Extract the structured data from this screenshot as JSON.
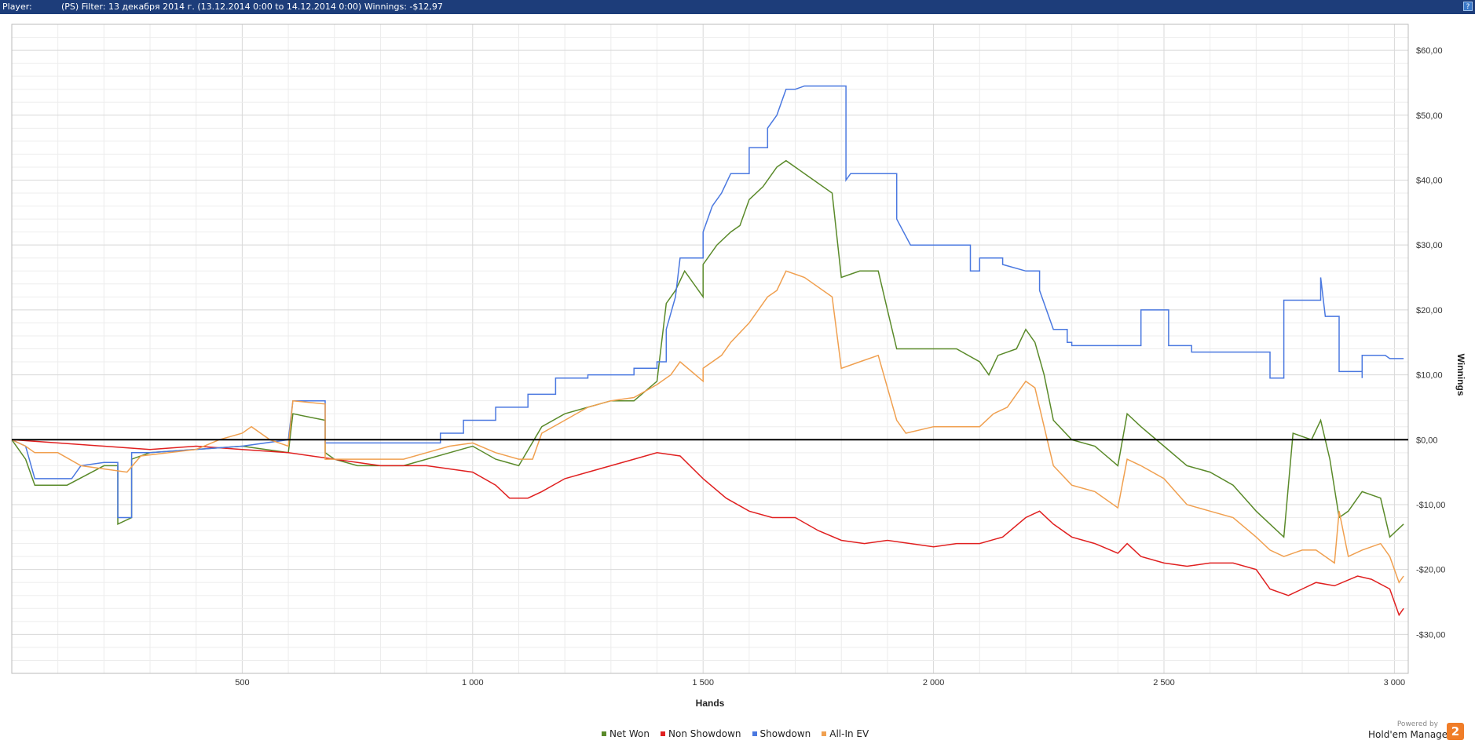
{
  "header": {
    "player_label": "Player:",
    "filter_text": "(PS) Filter: 13 декабря 2014 г. (13.12.2014 0:00 to 14.12.2014 0:00) Winnings: -$12,97",
    "help_label": "?"
  },
  "footer": {
    "powered_by": "Powered by",
    "brand": "Hold'em Manager",
    "logo_text": "2"
  },
  "chart_data": {
    "type": "line",
    "title": "",
    "xlabel": "Hands",
    "ylabel": "Winnings",
    "xlim": [
      0,
      3030
    ],
    "ylim": [
      -36,
      64
    ],
    "x_ticks": [
      500,
      1000,
      1500,
      2000,
      2500,
      3000
    ],
    "x_tick_labels": [
      "500",
      "1 000",
      "1 500",
      "2 000",
      "2 500",
      "3 000"
    ],
    "y_ticks": [
      -30,
      -20,
      -10,
      0,
      10,
      20,
      30,
      40,
      50,
      60
    ],
    "y_tick_labels": [
      "-$30,00",
      "-$20,00",
      "-$10,00",
      "$0,00",
      "$10,00",
      "$20,00",
      "$30,00",
      "$40,00",
      "$50,00",
      "$60,00"
    ],
    "grid": true,
    "legend_position": "bottom-center",
    "series": [
      {
        "name": "Net Won",
        "color": "#5a8a2a",
        "points": [
          [
            0,
            0
          ],
          [
            30,
            -3
          ],
          [
            50,
            -7
          ],
          [
            120,
            -7
          ],
          [
            200,
            -4
          ],
          [
            230,
            -4
          ],
          [
            230,
            -13
          ],
          [
            260,
            -12
          ],
          [
            260,
            -3
          ],
          [
            300,
            -2
          ],
          [
            500,
            -1
          ],
          [
            600,
            -2
          ],
          [
            610,
            4
          ],
          [
            680,
            3
          ],
          [
            680,
            -2
          ],
          [
            700,
            -3
          ],
          [
            750,
            -4
          ],
          [
            850,
            -4
          ],
          [
            900,
            -3
          ],
          [
            950,
            -2
          ],
          [
            1000,
            -1
          ],
          [
            1050,
            -3
          ],
          [
            1100,
            -4
          ],
          [
            1150,
            2
          ],
          [
            1200,
            4
          ],
          [
            1250,
            5
          ],
          [
            1300,
            6
          ],
          [
            1350,
            6
          ],
          [
            1400,
            9
          ],
          [
            1420,
            21
          ],
          [
            1440,
            23
          ],
          [
            1460,
            26
          ],
          [
            1500,
            22
          ],
          [
            1500,
            27
          ],
          [
            1530,
            30
          ],
          [
            1560,
            32
          ],
          [
            1580,
            33
          ],
          [
            1600,
            37
          ],
          [
            1630,
            39
          ],
          [
            1660,
            42
          ],
          [
            1680,
            43
          ],
          [
            1720,
            41
          ],
          [
            1780,
            38
          ],
          [
            1800,
            25
          ],
          [
            1840,
            26
          ],
          [
            1880,
            26
          ],
          [
            1900,
            20
          ],
          [
            1920,
            14
          ],
          [
            1950,
            14
          ],
          [
            2000,
            14
          ],
          [
            2050,
            14
          ],
          [
            2100,
            12
          ],
          [
            2120,
            10
          ],
          [
            2140,
            13
          ],
          [
            2180,
            14
          ],
          [
            2200,
            17
          ],
          [
            2220,
            15
          ],
          [
            2240,
            10
          ],
          [
            2260,
            3
          ],
          [
            2300,
            0
          ],
          [
            2350,
            -1
          ],
          [
            2400,
            -4
          ],
          [
            2420,
            4
          ],
          [
            2450,
            2
          ],
          [
            2500,
            -1
          ],
          [
            2550,
            -4
          ],
          [
            2600,
            -5
          ],
          [
            2650,
            -7
          ],
          [
            2700,
            -11
          ],
          [
            2730,
            -13
          ],
          [
            2760,
            -15
          ],
          [
            2780,
            1
          ],
          [
            2820,
            0
          ],
          [
            2840,
            3
          ],
          [
            2860,
            -3
          ],
          [
            2880,
            -12
          ],
          [
            2900,
            -11
          ],
          [
            2930,
            -8
          ],
          [
            2970,
            -9
          ],
          [
            2990,
            -15
          ],
          [
            3020,
            -13
          ]
        ]
      },
      {
        "name": "Non Showdown",
        "color": "#e02020",
        "points": [
          [
            0,
            0
          ],
          [
            100,
            -0.5
          ],
          [
            200,
            -1
          ],
          [
            300,
            -1.5
          ],
          [
            400,
            -1
          ],
          [
            500,
            -1.5
          ],
          [
            600,
            -2
          ],
          [
            700,
            -3
          ],
          [
            800,
            -4
          ],
          [
            900,
            -4
          ],
          [
            950,
            -4.5
          ],
          [
            1000,
            -5
          ],
          [
            1050,
            -7
          ],
          [
            1080,
            -9
          ],
          [
            1120,
            -9
          ],
          [
            1150,
            -8
          ],
          [
            1200,
            -6
          ],
          [
            1250,
            -5
          ],
          [
            1300,
            -4
          ],
          [
            1350,
            -3
          ],
          [
            1400,
            -2
          ],
          [
            1450,
            -2.5
          ],
          [
            1500,
            -6
          ],
          [
            1550,
            -9
          ],
          [
            1600,
            -11
          ],
          [
            1650,
            -12
          ],
          [
            1700,
            -12
          ],
          [
            1750,
            -14
          ],
          [
            1800,
            -15.5
          ],
          [
            1850,
            -16
          ],
          [
            1900,
            -15.5
          ],
          [
            1950,
            -16
          ],
          [
            2000,
            -16.5
          ],
          [
            2050,
            -16
          ],
          [
            2100,
            -16
          ],
          [
            2150,
            -15
          ],
          [
            2200,
            -12
          ],
          [
            2230,
            -11
          ],
          [
            2260,
            -13
          ],
          [
            2300,
            -15
          ],
          [
            2350,
            -16
          ],
          [
            2400,
            -17.5
          ],
          [
            2420,
            -16
          ],
          [
            2450,
            -18
          ],
          [
            2500,
            -19
          ],
          [
            2550,
            -19.5
          ],
          [
            2600,
            -19
          ],
          [
            2650,
            -19
          ],
          [
            2700,
            -20
          ],
          [
            2730,
            -23
          ],
          [
            2770,
            -24
          ],
          [
            2800,
            -23
          ],
          [
            2830,
            -22
          ],
          [
            2870,
            -22.5
          ],
          [
            2920,
            -21
          ],
          [
            2950,
            -21.5
          ],
          [
            2990,
            -23
          ],
          [
            3010,
            -27
          ],
          [
            3020,
            -26
          ]
        ]
      },
      {
        "name": "Showdown",
        "color": "#4a78e0",
        "points": [
          [
            0,
            0
          ],
          [
            30,
            -1
          ],
          [
            50,
            -6
          ],
          [
            130,
            -6
          ],
          [
            150,
            -4
          ],
          [
            200,
            -3.5
          ],
          [
            230,
            -3.5
          ],
          [
            230,
            -12
          ],
          [
            260,
            -12
          ],
          [
            260,
            -2
          ],
          [
            300,
            -2
          ],
          [
            500,
            -1
          ],
          [
            600,
            0
          ],
          [
            610,
            6
          ],
          [
            680,
            6
          ],
          [
            680,
            -0.5
          ],
          [
            930,
            -0.5
          ],
          [
            930,
            1
          ],
          [
            980,
            1
          ],
          [
            980,
            3
          ],
          [
            1050,
            3
          ],
          [
            1050,
            5
          ],
          [
            1120,
            5
          ],
          [
            1120,
            7
          ],
          [
            1180,
            7
          ],
          [
            1180,
            9.5
          ],
          [
            1250,
            9.5
          ],
          [
            1250,
            10
          ],
          [
            1350,
            10
          ],
          [
            1350,
            11
          ],
          [
            1400,
            11
          ],
          [
            1400,
            12
          ],
          [
            1420,
            12
          ],
          [
            1420,
            17
          ],
          [
            1440,
            22
          ],
          [
            1450,
            28
          ],
          [
            1500,
            28
          ],
          [
            1500,
            32
          ],
          [
            1520,
            36
          ],
          [
            1540,
            38
          ],
          [
            1560,
            41
          ],
          [
            1600,
            41
          ],
          [
            1600,
            45
          ],
          [
            1640,
            45
          ],
          [
            1640,
            48
          ],
          [
            1660,
            50
          ],
          [
            1680,
            54
          ],
          [
            1700,
            54
          ],
          [
            1720,
            54.5
          ],
          [
            1810,
            54.5
          ],
          [
            1810,
            40
          ],
          [
            1820,
            41
          ],
          [
            1920,
            41
          ],
          [
            1920,
            34
          ],
          [
            1950,
            30
          ],
          [
            2080,
            30
          ],
          [
            2080,
            26
          ],
          [
            2100,
            26
          ],
          [
            2100,
            28
          ],
          [
            2150,
            28
          ],
          [
            2150,
            27
          ],
          [
            2200,
            26
          ],
          [
            2230,
            26
          ],
          [
            2230,
            23
          ],
          [
            2260,
            17
          ],
          [
            2290,
            17
          ],
          [
            2290,
            15
          ],
          [
            2300,
            15
          ],
          [
            2300,
            14.5
          ],
          [
            2450,
            14.5
          ],
          [
            2450,
            20
          ],
          [
            2510,
            20
          ],
          [
            2510,
            14.5
          ],
          [
            2560,
            14.5
          ],
          [
            2560,
            13.5
          ],
          [
            2730,
            13.5
          ],
          [
            2730,
            9.5
          ],
          [
            2760,
            9.5
          ],
          [
            2760,
            21.5
          ],
          [
            2840,
            21.5
          ],
          [
            2840,
            25
          ],
          [
            2850,
            19
          ],
          [
            2880,
            19
          ],
          [
            2880,
            10.5
          ],
          [
            2930,
            10.5
          ],
          [
            2930,
            9.5
          ],
          [
            2930,
            13
          ],
          [
            2980,
            13
          ],
          [
            2990,
            12.5
          ],
          [
            3020,
            12.5
          ]
        ]
      },
      {
        "name": "All-In EV",
        "color": "#f0a050",
        "points": [
          [
            0,
            0
          ],
          [
            30,
            -1
          ],
          [
            50,
            -2
          ],
          [
            100,
            -2
          ],
          [
            150,
            -4
          ],
          [
            200,
            -4.5
          ],
          [
            250,
            -5
          ],
          [
            280,
            -2.5
          ],
          [
            400,
            -1.5
          ],
          [
            450,
            0
          ],
          [
            500,
            1
          ],
          [
            520,
            2
          ],
          [
            560,
            0
          ],
          [
            600,
            -1
          ],
          [
            610,
            6
          ],
          [
            680,
            5.5
          ],
          [
            680,
            -3
          ],
          [
            750,
            -3
          ],
          [
            850,
            -3
          ],
          [
            900,
            -2
          ],
          [
            950,
            -1
          ],
          [
            1000,
            -0.5
          ],
          [
            1050,
            -2
          ],
          [
            1100,
            -3
          ],
          [
            1130,
            -3
          ],
          [
            1150,
            1
          ],
          [
            1200,
            3
          ],
          [
            1250,
            5
          ],
          [
            1300,
            6
          ],
          [
            1350,
            6.5
          ],
          [
            1400,
            8.5
          ],
          [
            1430,
            10
          ],
          [
            1450,
            12
          ],
          [
            1500,
            9
          ],
          [
            1500,
            11
          ],
          [
            1540,
            13
          ],
          [
            1560,
            15
          ],
          [
            1600,
            18
          ],
          [
            1640,
            22
          ],
          [
            1660,
            23
          ],
          [
            1680,
            26
          ],
          [
            1720,
            25
          ],
          [
            1780,
            22
          ],
          [
            1800,
            11
          ],
          [
            1840,
            12
          ],
          [
            1880,
            13
          ],
          [
            1900,
            8
          ],
          [
            1920,
            3
          ],
          [
            1940,
            1
          ],
          [
            2000,
            2
          ],
          [
            2050,
            2
          ],
          [
            2100,
            2
          ],
          [
            2130,
            4
          ],
          [
            2160,
            5
          ],
          [
            2200,
            9
          ],
          [
            2220,
            8
          ],
          [
            2240,
            2
          ],
          [
            2260,
            -4
          ],
          [
            2300,
            -7
          ],
          [
            2350,
            -8
          ],
          [
            2400,
            -10.5
          ],
          [
            2420,
            -3
          ],
          [
            2450,
            -4
          ],
          [
            2500,
            -6
          ],
          [
            2550,
            -10
          ],
          [
            2600,
            -11
          ],
          [
            2650,
            -12
          ],
          [
            2700,
            -15
          ],
          [
            2730,
            -17
          ],
          [
            2760,
            -18
          ],
          [
            2800,
            -17
          ],
          [
            2830,
            -17
          ],
          [
            2850,
            -18
          ],
          [
            2870,
            -19
          ],
          [
            2880,
            -11
          ],
          [
            2900,
            -18
          ],
          [
            2930,
            -17
          ],
          [
            2970,
            -16
          ],
          [
            2990,
            -18
          ],
          [
            3010,
            -22
          ],
          [
            3020,
            -21
          ]
        ]
      }
    ]
  }
}
